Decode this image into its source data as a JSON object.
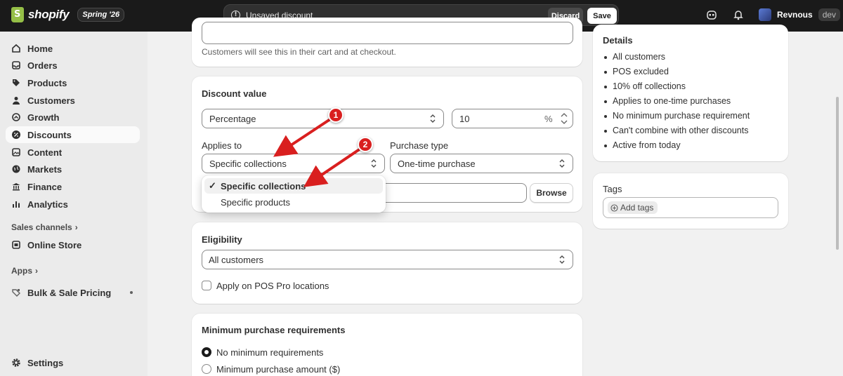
{
  "topbar": {
    "brand": "shopify",
    "edition": "Spring '26",
    "unsaved_message": "Unsaved discount",
    "discard_label": "Discard",
    "save_label": "Save",
    "user_name": "Revnous",
    "user_tag": "dev"
  },
  "sidebar": {
    "items": [
      {
        "label": "Home",
        "icon": "home-icon"
      },
      {
        "label": "Orders",
        "icon": "inbox-icon"
      },
      {
        "label": "Products",
        "icon": "tag-icon"
      },
      {
        "label": "Customers",
        "icon": "person-icon"
      },
      {
        "label": "Growth",
        "icon": "growth-icon"
      },
      {
        "label": "Discounts",
        "icon": "discount-icon",
        "active": true
      },
      {
        "label": "Content",
        "icon": "content-icon"
      },
      {
        "label": "Markets",
        "icon": "globe-icon"
      },
      {
        "label": "Finance",
        "icon": "bank-icon"
      },
      {
        "label": "Analytics",
        "icon": "chart-icon"
      }
    ],
    "sales_channels_label": "Sales channels",
    "online_store_label": "Online Store",
    "apps_label": "Apps",
    "app_item_label": "Bulk & Sale Pricing",
    "settings_label": "Settings"
  },
  "main": {
    "title_help": "Customers will see this in their cart and at checkout.",
    "discount_value": {
      "heading": "Discount value",
      "type_value": "Percentage",
      "amount_value": "10",
      "amount_suffix": "%",
      "applies_to_label": "Applies to",
      "applies_to_value": "Specific collections",
      "purchase_type_label": "Purchase type",
      "purchase_type_value": "One-time purchase",
      "browse_label": "Browse",
      "dropdown_options": [
        "Specific collections",
        "Specific products"
      ],
      "selected_option_index": 0
    },
    "eligibility": {
      "heading": "Eligibility",
      "value": "All customers",
      "pos_checkbox_label": "Apply on POS Pro locations"
    },
    "min_purchase": {
      "heading": "Minimum purchase requirements",
      "options": [
        "No minimum requirements",
        "Minimum purchase amount ($)"
      ],
      "selected_index": 0
    }
  },
  "details": {
    "heading": "Details",
    "items": [
      "All customers",
      "POS excluded",
      "10% off collections",
      "Applies to one-time purchases",
      "No minimum purchase requirement",
      "Can't combine with other discounts",
      "Active from today"
    ]
  },
  "tags": {
    "heading": "Tags",
    "add_label": "Add tags"
  },
  "annotations": {
    "marker_1": "1",
    "marker_2": "2",
    "color": "#d91f1f"
  }
}
